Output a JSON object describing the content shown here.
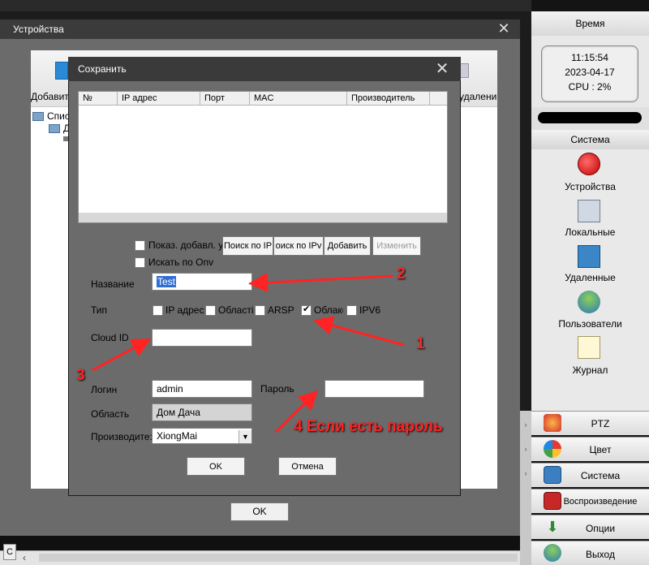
{
  "outer_window": {
    "title": "Устройства",
    "toolbar_add": "Добавит",
    "toolbar_delete": "удалени",
    "tree_item_1": "Спис",
    "tree_item_2": "Д",
    "ok_label": "OK"
  },
  "dialog": {
    "title": "Сохранить",
    "columns": [
      "№",
      "IP адрес",
      "Порт",
      "MAC",
      "Производитель"
    ],
    "show_added_label": "Показ. добавл. у",
    "search_onvif_label": "Искать по Onv",
    "buttons": {
      "search_ip": "Поиск по IP",
      "search_ipv": "оиск по IPv",
      "add": "Добавить",
      "change": "Изменить"
    },
    "name_label": "Название",
    "name_value": "Test",
    "type_label": "Тип",
    "type_options": [
      "IP адрес",
      "Області",
      "ARSP",
      "Облако",
      "IPV6"
    ],
    "type_selected": "Облако",
    "cloud_id_label": "Cloud ID",
    "cloud_id_value": "",
    "login_label": "Логин",
    "login_value": "admin",
    "password_label": "Пароль",
    "password_value": "",
    "area_label": "Область",
    "area_value": "Дом Дача",
    "vendor_label": "Производите:",
    "vendor_value": "XiongMai",
    "ok_label": "OK",
    "cancel_label": "Отмена"
  },
  "right_panel": {
    "time_header": "Время",
    "clock_time": "11:15:54",
    "clock_date": "2023-04-17",
    "cpu": "CPU : 2%",
    "system_header": "Система",
    "menu": [
      {
        "label": "Устройства",
        "icon": "devices-icon"
      },
      {
        "label": "Локальные",
        "icon": "local-icon"
      },
      {
        "label": "Удаленные",
        "icon": "remote-icon"
      },
      {
        "label": "Пользователи",
        "icon": "users-icon"
      },
      {
        "label": "Журнал",
        "icon": "journal-icon"
      }
    ],
    "tabs": [
      {
        "label": "PTZ",
        "icon": "ptz-icon"
      },
      {
        "label": "Цвет",
        "icon": "color-icon"
      },
      {
        "label": "Система",
        "icon": "system-icon"
      },
      {
        "label": "Воспроизведение",
        "icon": "playback-icon"
      },
      {
        "label": "Опции",
        "icon": "options-icon"
      },
      {
        "label": "Выход",
        "icon": "exit-icon"
      }
    ]
  },
  "annotations": {
    "n1": "1",
    "n2": "2",
    "n3": "3",
    "n4": "4 Если есть пароль",
    "color": "#ff2323"
  }
}
